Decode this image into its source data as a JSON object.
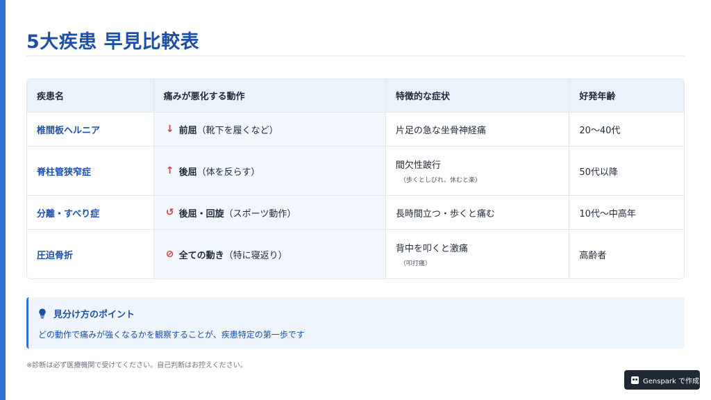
{
  "title": "5大疾患 早見比較表",
  "table": {
    "headers": [
      "疾患名",
      "痛みが悪化する動作",
      "特徴的な症状",
      "好発年齢"
    ],
    "rows": [
      {
        "disease": "椎間板ヘルニア",
        "motion_icon": "down-arrow-icon",
        "motion_glyph": "↓",
        "motion_bold": "前屈",
        "motion_rest": "（靴下を履くなど）",
        "symptom": "片足の急な坐骨神経痛",
        "symptom_sub": "",
        "age": "20〜40代"
      },
      {
        "disease": "脊柱管狭窄症",
        "motion_icon": "up-arrow-icon",
        "motion_glyph": "↑",
        "motion_bold": "後屈",
        "motion_rest": "（体を反らす）",
        "symptom": "間欠性跛行",
        "symptom_sub": "（歩くとしびれ、休むと楽）",
        "age": "50代以降"
      },
      {
        "disease": "分離・すべり症",
        "motion_icon": "rotate-icon",
        "motion_glyph": "↺",
        "motion_bold": "後屈・回旋",
        "motion_rest": "（スポーツ動作）",
        "symptom": "長時間立つ・歩くと痛む",
        "symptom_sub": "",
        "age": "10代〜中高年"
      },
      {
        "disease": "圧迫骨折",
        "motion_icon": "prohibited-icon",
        "motion_glyph": "⊘",
        "motion_bold": "全ての動き",
        "motion_rest": "（特に寝返り）",
        "symptom": "背中を叩くと激痛",
        "symptom_sub": "（叩打痛）",
        "age": "高齢者"
      }
    ]
  },
  "point": {
    "icon": "lightbulb-icon",
    "heading": "見分け方のポイント",
    "text": "どの動作で痛みが強くなるかを観察することが、疾患特定の第一歩です"
  },
  "note": "※診断は必ず医療機関で受けてください。自己判断はお控えください。",
  "badge": {
    "label": "Genspark で作成"
  },
  "colors": {
    "accent": "#2f6fd6",
    "title": "#1e4fa8",
    "header_bg": "#eaf3fc",
    "motion_icon": "#dc3b3b"
  }
}
